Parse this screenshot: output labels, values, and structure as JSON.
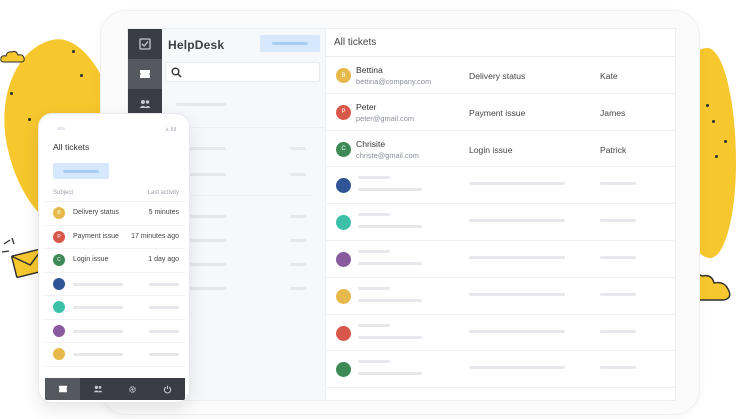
{
  "colors": {
    "accent_yellow": "#f7c72e",
    "rail_dark": "#3a3d44",
    "button_blue": "#d6e8fb",
    "avatar_yellow": "#e7b84a",
    "avatar_red": "#d9574a",
    "avatar_green": "#3d8a57",
    "avatar_blue": "#2f5597",
    "avatar_teal": "#3cc0a8",
    "avatar_purple": "#8a5a9e"
  },
  "rail": {
    "items": [
      {
        "icon": "checkbox-icon",
        "active": false
      },
      {
        "icon": "ticket-icon",
        "active": true
      },
      {
        "icon": "users-icon",
        "active": false
      }
    ]
  },
  "sidebar": {
    "brand": "HelpDesk",
    "search_icon": "search-icon"
  },
  "main": {
    "title": "All tickets",
    "tickets": [
      {
        "initial": "B",
        "name": "Bettina",
        "email": "bettina@company.com",
        "subject": "Delivery status",
        "agent": "Kate",
        "color": "#e7b84a"
      },
      {
        "initial": "P",
        "name": "Peter",
        "email": "peter@gmail.com",
        "subject": "Payment issue",
        "agent": "James",
        "color": "#d9574a"
      },
      {
        "initial": "C",
        "name": "Chrisite",
        "email": "christe@gmail.com",
        "subject": "Login issue",
        "agent": "Patrick",
        "color": "#3d8a57"
      }
    ],
    "placeholder_colors": [
      "#2f5597",
      "#3cc0a8",
      "#8a5a9e",
      "#e7b84a",
      "#d9574a",
      "#3d8a57"
    ]
  },
  "phone": {
    "title": "All tickets",
    "col_subject": "Subject",
    "col_activity": "Last activity",
    "tickets": [
      {
        "initial": "B",
        "subject": "Delivery status",
        "activity": "5 minutes",
        "color": "#e7b84a"
      },
      {
        "initial": "P",
        "subject": "Payment issue",
        "activity": "17 minutes ago",
        "color": "#d9574a"
      },
      {
        "initial": "C",
        "subject": "Login issue",
        "activity": "1 day ago",
        "color": "#3d8a57"
      }
    ],
    "placeholder_colors": [
      "#2f5597",
      "#3cc0a8",
      "#8a5a9e",
      "#e7b84a"
    ],
    "nav": [
      {
        "icon": "ticket-icon",
        "active": true
      },
      {
        "icon": "users-icon",
        "active": false
      },
      {
        "icon": "gear-icon",
        "active": false
      },
      {
        "icon": "power-icon",
        "active": false
      }
    ]
  }
}
